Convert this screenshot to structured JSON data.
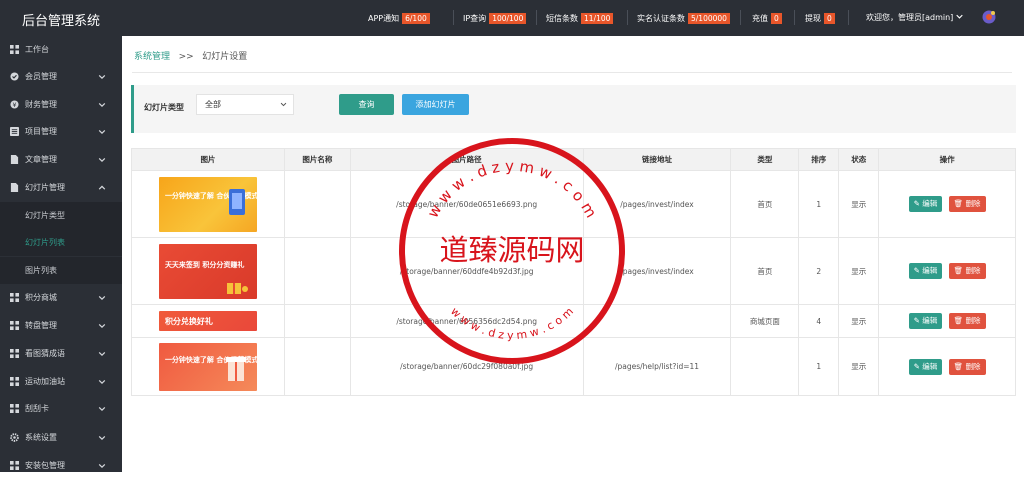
{
  "header": {
    "title": "后台管理系统",
    "stats": [
      {
        "label": "APP通知",
        "badge": "6/100"
      },
      {
        "label": "IP查询",
        "badge": "100/100"
      },
      {
        "label": "短信条数",
        "badge": "11/100"
      },
      {
        "label": "实名认证条数",
        "badge": "5/100000"
      },
      {
        "label": "充值",
        "badge": "0"
      },
      {
        "label": "提现",
        "badge": "0"
      }
    ],
    "welcome": "欢迎您，管理员[admin]"
  },
  "sidebar": {
    "items": [
      {
        "label": "工作台",
        "icon": "dashboard-icon"
      },
      {
        "label": "会员管理",
        "icon": "user-check-icon"
      },
      {
        "label": "财务管理",
        "icon": "money-icon"
      },
      {
        "label": "项目管理",
        "icon": "list-icon"
      },
      {
        "label": "文章管理",
        "icon": "file-icon"
      },
      {
        "label": "幻灯片管理",
        "icon": "file-icon"
      },
      {
        "label": "积分商城",
        "icon": "grid-icon"
      },
      {
        "label": "转盘管理",
        "icon": "grid-icon"
      },
      {
        "label": "看图猜成语",
        "icon": "grid-icon"
      },
      {
        "label": "运动加油站",
        "icon": "grid-icon"
      },
      {
        "label": "刮刮卡",
        "icon": "grid-icon"
      },
      {
        "label": "系统设置",
        "icon": "gear-icon"
      },
      {
        "label": "安装包管理",
        "icon": "grid-icon"
      }
    ],
    "subitems": [
      {
        "label": "幻灯片类型"
      },
      {
        "label": "幻灯片列表"
      },
      {
        "label": "图片列表"
      }
    ]
  },
  "breadcrumb": {
    "parent": "系统管理",
    "sep": ">>",
    "current": "幻灯片设置"
  },
  "filter": {
    "label": "幻灯片类型",
    "selected": "全部",
    "query_label": "查询",
    "add_label": "添加幻灯片"
  },
  "table": {
    "headers": [
      "图片",
      "图片名称",
      "图片路径",
      "链接地址",
      "类型",
      "排序",
      "状态",
      "操作"
    ],
    "rows": [
      {
        "banner": "一分钟快速了解 合伙经营模式",
        "path": "/storage/banner/60de0651e6693.png",
        "link": "/pages/invest/index",
        "type": "首页",
        "sort": "1",
        "status": "显示"
      },
      {
        "banner": "天天来签到 积分分资赚礼",
        "path": "/storage/banner/60ddfe4b92d3f.jpg",
        "link": "/pages/invest/index",
        "type": "首页",
        "sort": "2",
        "status": "显示"
      },
      {
        "banner": "积分兑换好礼",
        "path": "/storage/banner/6056356dc2d54.png",
        "link": "",
        "type": "商城页面",
        "sort": "4",
        "status": "显示"
      },
      {
        "banner": "一分钟快速了解 合伙经营模式",
        "path": "/storage/banner/60dc29f080a0f.jpg",
        "link": "/pages/help/list?id=11",
        "type": "",
        "sort": "1",
        "status": "显示"
      }
    ],
    "edit_label": "编辑",
    "delete_label": "删除"
  },
  "watermark": {
    "center": "道臻源码网",
    "ring_top": "w w w . d z y m w . c o m",
    "ring_bottom": "w w w . d z y m w . c o m"
  },
  "colors": {
    "accent": "#2f9c8a",
    "danger": "#e0523e",
    "info": "#3aa5df",
    "topbar": "#2b2f36",
    "badge": "#e8562a",
    "watermark": "#d8141c"
  }
}
